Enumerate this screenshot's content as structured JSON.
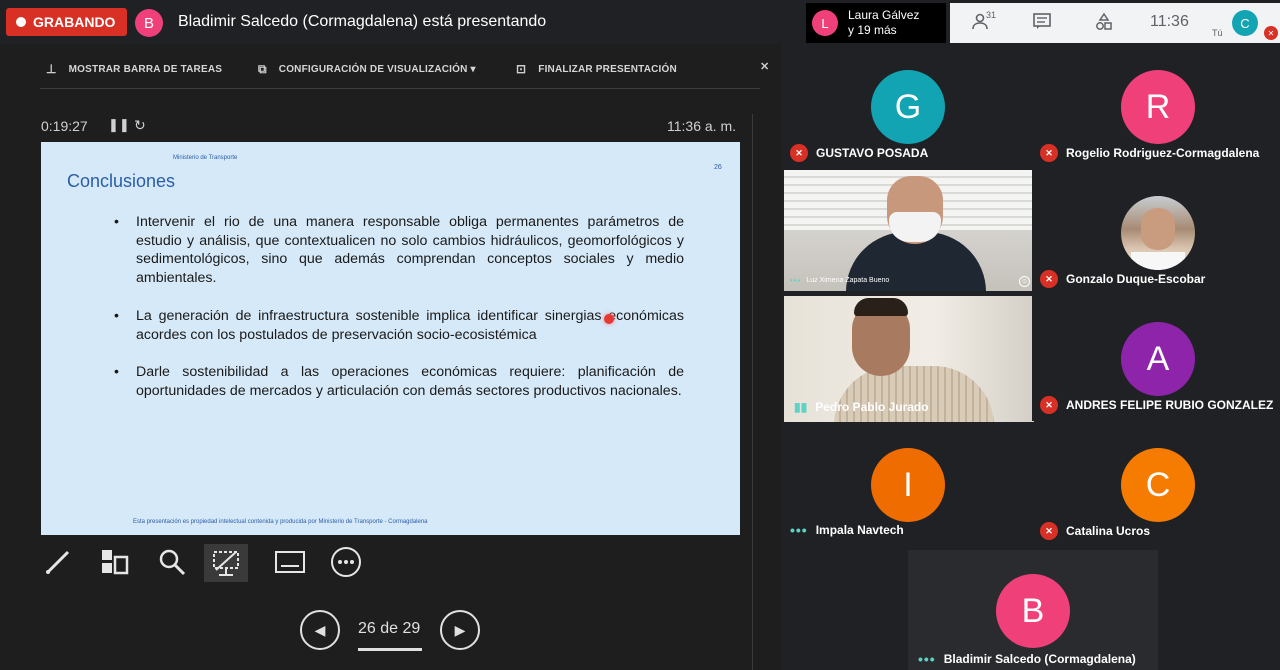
{
  "topbar": {
    "recording_label": "GRABANDO",
    "presenter_initial": "B",
    "presenter_text": "Bladimir Salcedo (Cormagdalena) está presentando",
    "notification": {
      "initial": "L",
      "line1": "Laura Gálvez",
      "line2": "y 19 más"
    },
    "participants_count": "31",
    "clock": "11:36",
    "self_label": "Tú",
    "self_initial": "C"
  },
  "presenter_toolbar": {
    "show_taskbar": "MOSTRAR BARRA DE TAREAS",
    "display_settings": "CONFIGURACIÓN DE VISUALIZACIÓN ▾",
    "end_presentation": "FINALIZAR PRESENTACIÓN"
  },
  "timer": {
    "elapsed": "0:19:27",
    "clock": "11:36 a. m."
  },
  "slide": {
    "org": "Ministerio de Transporte",
    "number": "26",
    "title": "Conclusiones",
    "bullets": {
      "b1": "Intervenir el rio de una manera responsable obliga permanentes parámetros de estudio y análisis, que contextualicen no solo cambios hidráulicos, geomorfológicos y sedimentológicos, sino que además comprendan conceptos sociales y medio ambientales.",
      "b2": "La generación de infraestructura sostenible implica identificar sinergias económicas acordes con los postulados de preservación socio-ecosistémica",
      "b3": "Darle sostenibilidad a las operaciones económicas requiere: planificación de oportunidades de mercados y articulación con demás sectores productivos nacionales."
    },
    "footer": "Esta presentación es propiedad intelectual contenida y producida por Ministerio de Transporte - Cormagdalena"
  },
  "navigation": {
    "page_label": "26 de 29"
  },
  "participants": {
    "p1": {
      "initial": "G",
      "name": "GUSTAVO POSADA",
      "color": "#12a4b3"
    },
    "p2": {
      "initial": "R",
      "name": "Rogelio Rodriguez-Cormagdalena",
      "color": "#f0407a"
    },
    "p3": {
      "name": "Luz Ximena Zapata Bueno"
    },
    "p4": {
      "name": "Gonzalo Duque-Escobar"
    },
    "p5": {
      "name": "Pedro Pablo Jurado"
    },
    "p6": {
      "initial": "A",
      "name": "ANDRES FELIPE RUBIO GONZALEZ",
      "color": "#8e24aa"
    },
    "p7": {
      "initial": "I",
      "name": "Impala Navtech",
      "color": "#ef6c00"
    },
    "p8": {
      "initial": "C",
      "name": "Catalina Ucros",
      "color": "#f57c00"
    },
    "p9": {
      "initial": "B",
      "name": "Bladimir Salcedo (Cormagdalena)",
      "color": "#f0407a"
    }
  },
  "colors": {
    "recording": "#d93025",
    "accent_teal": "#12a4b3",
    "slide_bg": "#d6e9f8",
    "slide_title": "#2b5da8"
  }
}
